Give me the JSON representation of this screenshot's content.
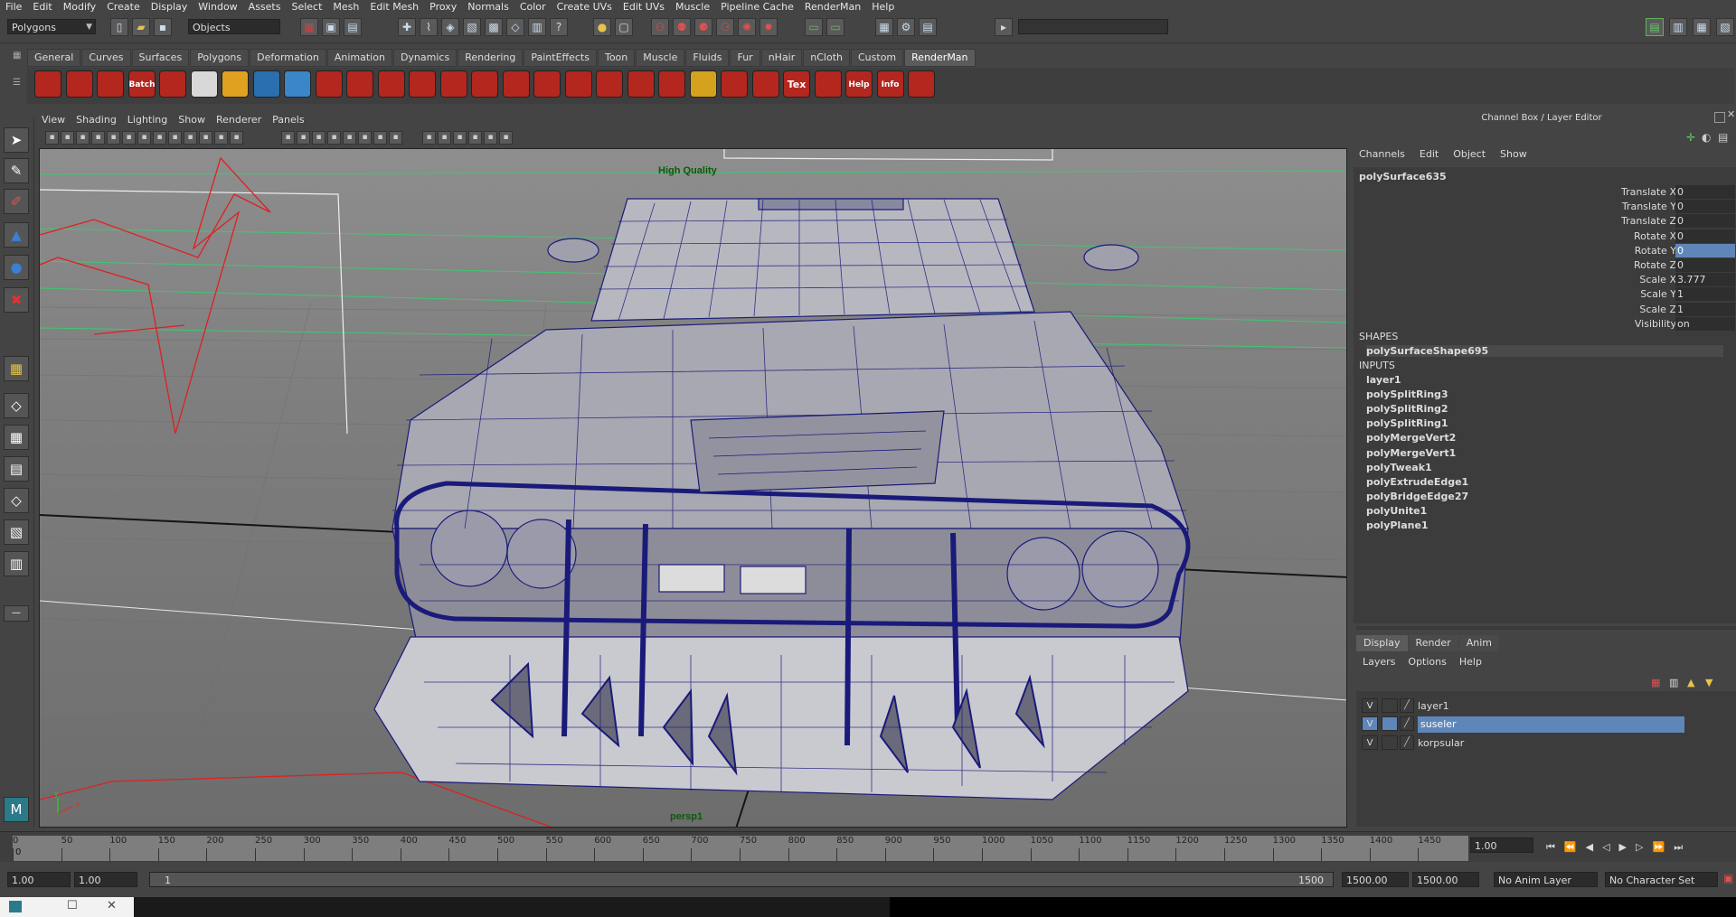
{
  "menubar": [
    "File",
    "Edit",
    "Modify",
    "Create",
    "Display",
    "Window",
    "Assets",
    "Select",
    "Mesh",
    "Edit Mesh",
    "Proxy",
    "Normals",
    "Color",
    "Create UVs",
    "Edit UVs",
    "Muscle",
    "Pipeline Cache",
    "RenderMan",
    "Help"
  ],
  "status": {
    "menuset": "Polygons",
    "selection_mode": "Objects"
  },
  "shelf": {
    "tabs": [
      "General",
      "Curves",
      "Surfaces",
      "Polygons",
      "Deformation",
      "Animation",
      "Dynamics",
      "Rendering",
      "PaintEffects",
      "Toon",
      "Muscle",
      "Fluids",
      "Fur",
      "nHair",
      "nCloth",
      "Custom",
      "RenderMan"
    ],
    "active_tab": "RenderMan",
    "icons": [
      {
        "name": "renderman-render-icon",
        "color": "#b3271f",
        "label": ""
      },
      {
        "name": "renderman-clapper-icon",
        "color": "#b3271f",
        "label": ""
      },
      {
        "name": "renderman-gear-icon",
        "color": "#b3271f",
        "label": ""
      },
      {
        "name": "renderman-batch-icon",
        "color": "#b3271f",
        "label": "Batch"
      },
      {
        "name": "renderman-disable-icon",
        "color": "#b3271f",
        "label": ""
      },
      {
        "name": "renderman-eye-icon",
        "color": "#d8d8d8",
        "label": ""
      },
      {
        "name": "renderman-light-icon",
        "color": "#e0a020",
        "label": ""
      },
      {
        "name": "renderman-globe-icon",
        "color": "#2a6fb0",
        "label": ""
      },
      {
        "name": "renderman-sphere-icon",
        "color": "#3a86c8",
        "label": ""
      },
      {
        "name": "renderman-shader-icon",
        "color": "#b3271f",
        "label": ""
      },
      {
        "name": "renderman-bulb-icon",
        "color": "#b3271f",
        "label": ""
      },
      {
        "name": "renderman-dial-icon",
        "color": "#b3271f",
        "label": ""
      },
      {
        "name": "renderman-dial2-icon",
        "color": "#b3271f",
        "label": ""
      },
      {
        "name": "renderman-layers-icon",
        "color": "#b3271f",
        "label": ""
      },
      {
        "name": "renderman-sheet-icon",
        "color": "#b3271f",
        "label": ""
      },
      {
        "name": "renderman-cloth-icon",
        "color": "#b3271f",
        "label": ""
      },
      {
        "name": "renderman-box-icon",
        "color": "#b3271f",
        "label": ""
      },
      {
        "name": "renderman-swirl-icon",
        "color": "#b3271f",
        "label": ""
      },
      {
        "name": "renderman-search-icon",
        "color": "#b3271f",
        "label": ""
      },
      {
        "name": "renderman-zoom-icon",
        "color": "#b3271f",
        "label": ""
      },
      {
        "name": "renderman-node-icon",
        "color": "#b3271f",
        "label": ""
      },
      {
        "name": "renderman-coin-icon",
        "color": "#d4a21c",
        "label": ""
      },
      {
        "name": "renderman-move-icon",
        "color": "#b3271f",
        "label": ""
      },
      {
        "name": "renderman-cube-icon",
        "color": "#b3271f",
        "label": ""
      },
      {
        "name": "renderman-tex-icon",
        "color": "#b3271f",
        "label": "Tex"
      },
      {
        "name": "renderman-vcr-icon",
        "color": "#b3271f",
        "label": ""
      },
      {
        "name": "renderman-help-icon",
        "color": "#b3271f",
        "label": "Help"
      },
      {
        "name": "renderman-info-icon",
        "color": "#b3271f",
        "label": "Info"
      },
      {
        "name": "renderman-plugin-icon",
        "color": "#b3271f",
        "label": ""
      }
    ]
  },
  "viewport": {
    "menu": [
      "View",
      "Shading",
      "Lighting",
      "Show",
      "Renderer",
      "Panels"
    ],
    "hud_top": "High Quality",
    "camera": "persp1",
    "wire_color": "#1a1a7a"
  },
  "channel_box": {
    "title": "Channel Box / Layer Editor",
    "menu": [
      "Channels",
      "Edit",
      "Object",
      "Show"
    ],
    "object": "polySurface635",
    "channels": [
      {
        "label": "Translate X",
        "value": "0"
      },
      {
        "label": "Translate Y",
        "value": "0"
      },
      {
        "label": "Translate Z",
        "value": "0"
      },
      {
        "label": "Rotate X",
        "value": "0"
      },
      {
        "label": "Rotate Y",
        "value": "0",
        "selected": true
      },
      {
        "label": "Rotate Z",
        "value": "0"
      },
      {
        "label": "Scale X",
        "value": "3.777"
      },
      {
        "label": "Scale Y",
        "value": "1"
      },
      {
        "label": "Scale Z",
        "value": "1"
      },
      {
        "label": "Visibility",
        "value": "on"
      }
    ],
    "shapes_header": "SHAPES",
    "shapes": [
      "polySurfaceShape695"
    ],
    "inputs_header": "INPUTS",
    "inputs": [
      "layer1",
      "polySplitRing3",
      "polySplitRing2",
      "polySplitRing1",
      "polyMergeVert2",
      "polyMergeVert1",
      "polyTweak1",
      "polyExtrudeEdge1",
      "polyBridgeEdge27",
      "polyUnite1",
      "polyPlane1"
    ]
  },
  "layer_editor": {
    "tabs": [
      "Display",
      "Render",
      "Anim"
    ],
    "active_tab": "Display",
    "menu": [
      "Layers",
      "Options",
      "Help"
    ],
    "layers": [
      {
        "visible": "V",
        "name": "layer1",
        "selected": false
      },
      {
        "visible": "V",
        "name": "suseler",
        "selected": true
      },
      {
        "visible": "V",
        "name": "korpsular",
        "selected": false
      }
    ]
  },
  "time_slider": {
    "ticks": [
      "0",
      "50",
      "100",
      "150",
      "200",
      "250",
      "300",
      "350",
      "400",
      "450",
      "500",
      "550",
      "600",
      "650",
      "700",
      "750",
      "800",
      "850",
      "900",
      "950",
      "1000",
      "1050",
      "1100",
      "1150",
      "1200",
      "1250",
      "1300",
      "1350",
      "1400",
      "1450"
    ],
    "start_label": "0",
    "current_frame": "1.00"
  },
  "range_slider": {
    "start_time": "1.00",
    "playback_start": "1.00",
    "range_start": "1",
    "range_end": "1500",
    "playback_end": "1500.00",
    "end_time": "1500.00",
    "anim_layer": "No Anim Layer",
    "character_set": "No Character Set"
  }
}
